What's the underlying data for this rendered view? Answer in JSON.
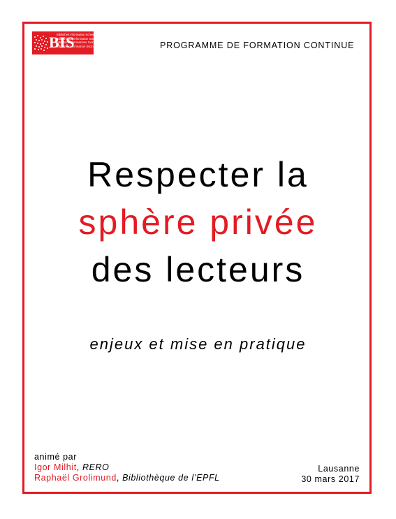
{
  "header": {
    "logo_word": "BIS",
    "logo_lines": [
      "Bibliothek Information Schweiz",
      "Bibliothèque Information Suisse",
      "Biblioteca Informazione Svizzera",
      "Biblioteca Informaziun Svizra"
    ],
    "programme": "PROGRAMME DE FORMATION CONTINUE"
  },
  "title": {
    "line1": "Respecter la",
    "line2": "sphère privée",
    "line3": "des lecteurs"
  },
  "subtitle": "enjeux et mise en pratique",
  "credits": {
    "intro": "animé par",
    "people": [
      {
        "name": "Igor Milhit",
        "sep": ", ",
        "org": "RERO"
      },
      {
        "name": "Raphaël Grolimund",
        "sep": ", ",
        "org": "Bibliothèque de l’EPFL"
      }
    ]
  },
  "event": {
    "city": "Lausanne",
    "date": "30 mars 2017"
  },
  "colors": {
    "accent": "#e31b23",
    "text": "#000000"
  }
}
